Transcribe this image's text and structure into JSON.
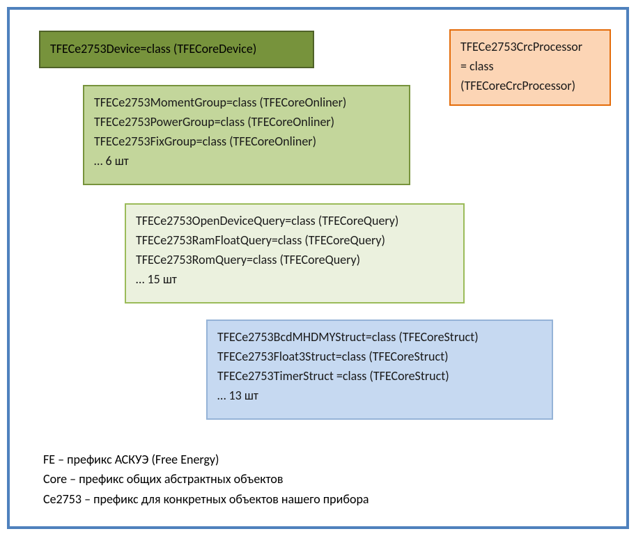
{
  "boxes": {
    "device": {
      "line1": "TFECe2753Device=class (TFECoreDevice)"
    },
    "crc": {
      "line1": "TFECe2753CrcProcessor",
      "line2": "= class",
      "line3": "(TFECoreCrcProcessor)"
    },
    "groups": {
      "line1": "TFECe2753MomentGroup=class (TFECoreOnliner)",
      "line2": "TFECe2753PowerGroup=class (TFECoreOnliner)",
      "line3": "TFECe2753FixGroup=class (TFECoreOnliner)",
      "line4": "… 6 шт"
    },
    "queries": {
      "line1": "TFECe2753OpenDeviceQuery=class (TFECoreQuery)",
      "line2": "TFECe2753RamFloatQuery=class (TFECoreQuery)",
      "line3": "TFECe2753RomQuery=class (TFECoreQuery)",
      "line4": "… 15 шт"
    },
    "structs": {
      "line1": "TFECe2753BcdMHDMYStruct=class (TFECoreStruct)",
      "line2": "TFECe2753Float3Struct=class (TFECoreStruct)",
      "line3": "TFECe2753TimerStruct =class (TFECoreStruct)",
      "line4": "… 13 шт"
    }
  },
  "legend": {
    "line1": "FE – префикс АСКУЭ (Free Energy)",
    "line2": "Core – префикс общих абстрактных объектов",
    "line3": "Ce2753 – префикс для конкретных объектов нашего прибора"
  },
  "colors": {
    "frame_border": "#4f81bd",
    "device_bg": "#77933c",
    "device_border": "#4f6228",
    "crc_bg": "#fcd5b5",
    "crc_border": "#e46c0a",
    "groups_bg": "#c3d69b",
    "groups_border": "#77933c",
    "queries_bg": "#ebf1de",
    "queries_border": "#9bbb59",
    "structs_bg": "#c6d9f1",
    "structs_border": "#95b3d7"
  }
}
